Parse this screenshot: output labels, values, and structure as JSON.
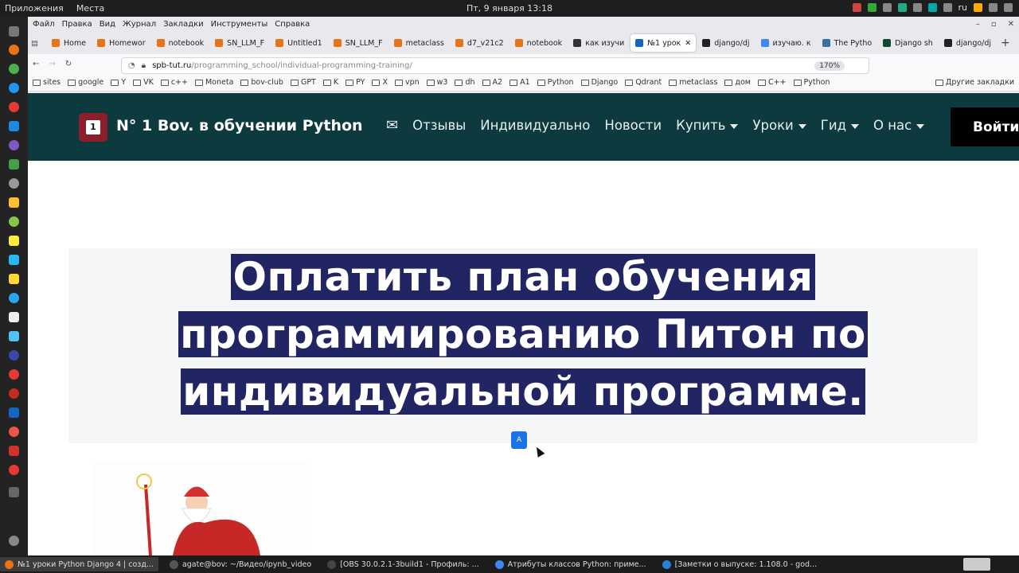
{
  "system": {
    "apps_label": "Приложения",
    "places_label": "Места",
    "clock": "Пт, 9 января  13:18",
    "lang": "ru"
  },
  "browser": {
    "menu": [
      "Файл",
      "Правка",
      "Вид",
      "Журнал",
      "Закладки",
      "Инструменты",
      "Справка"
    ],
    "tabs": [
      {
        "label": "Home",
        "color": "#e8741a"
      },
      {
        "label": "Homewor",
        "color": "#e8741a"
      },
      {
        "label": "notebook",
        "color": "#e8741a"
      },
      {
        "label": "SN_LLM_F",
        "color": "#e8741a"
      },
      {
        "label": "Untitled1",
        "color": "#e8741a"
      },
      {
        "label": "SN_LLM_F",
        "color": "#e8741a"
      },
      {
        "label": "metaclass",
        "color": "#e8741a"
      },
      {
        "label": "d7_v21c2",
        "color": "#e8741a"
      },
      {
        "label": "notebook",
        "color": "#e8741a"
      },
      {
        "label": "как изучи",
        "color": "#333"
      },
      {
        "label": "№1 урок",
        "color": "#1565c0"
      },
      {
        "label": "django/dj",
        "color": "#222"
      },
      {
        "label": "изучаю. к",
        "color": "#4285f4"
      },
      {
        "label": "The Pytho",
        "color": "#3572a5"
      },
      {
        "label": "Django sh",
        "color": "#0c4b33"
      },
      {
        "label": "django/dj",
        "color": "#222"
      }
    ],
    "url_host": "spb-tut.ru",
    "url_path": "/programming_school/individual-programming-training/",
    "zoom": "170%",
    "bookmarks": [
      "sites",
      "google",
      "Y",
      "VK",
      "c++",
      "Moneta",
      "bov-club",
      "GPT",
      "K",
      "PY",
      "X",
      "vpn",
      "w3",
      "dh",
      "A2",
      "A1",
      "Python",
      "Django",
      "Qdrant",
      "metaclass",
      "дом",
      "C++",
      "Python"
    ],
    "other_bookmarks": "Другие закладки"
  },
  "site": {
    "logo_num": "1",
    "brand": "N° 1 Bov. в обучении Python",
    "nav": [
      "Отзывы",
      "Индивидуально",
      "Новости",
      "Купить",
      "Уроки",
      "Гид",
      "О нас"
    ],
    "nav_dropdown": [
      false,
      false,
      false,
      true,
      true,
      true,
      true
    ],
    "login": "Войти",
    "hero_title": "Оплатить план обучения программированию Питон по индивидуальной программе.",
    "translate_icon": "A"
  },
  "taskbar": [
    {
      "label": "№1 уроки Python Django 4 | созд...",
      "active": true,
      "color": "#e8741a"
    },
    {
      "label": "agate@bov: ~/Видео/ipynb_video",
      "active": false,
      "color": "#555"
    },
    {
      "label": "[OBS 30.0.2.1-3build1 - Профиль: ...",
      "active": false,
      "color": "#444"
    },
    {
      "label": "Атрибуты классов Python: приме...",
      "active": false,
      "color": "#4285f4"
    },
    {
      "label": "[Заметки о выпуске: 1.108.0 - god...",
      "active": false,
      "color": "#2a7fd4"
    }
  ]
}
